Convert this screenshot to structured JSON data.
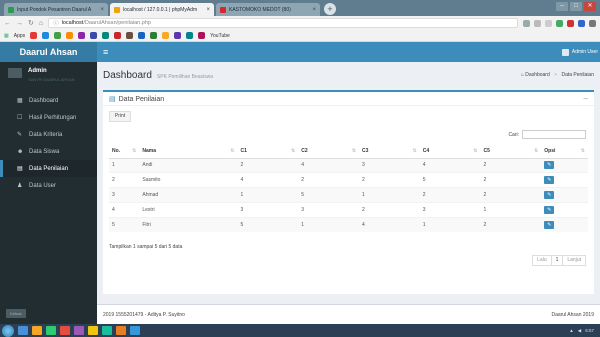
{
  "browser": {
    "tabs": [
      {
        "label": "Input Pondok Pesantren Daarul A",
        "color": "#2a9d4a",
        "active": false
      },
      {
        "label": "localhost / 127.0.0.1 | phpMyAdm",
        "color": "#f0a30a",
        "active": true
      },
      {
        "label": "KASTOMOKO MEDOT (80)",
        "color": "#d8262b",
        "active": false
      }
    ],
    "url_host": "localhost",
    "url_path": "/DaarulAhsan/penilaian.php",
    "bookmarks_label": "Apps",
    "bookmark_youtube": "YouTube",
    "bookmark_colors": [
      "#e53935",
      "#1e88e5",
      "#43a047",
      "#fb8c00",
      "#8e24aa",
      "#3949ab",
      "#00897b",
      "#c62828",
      "#6d4c41",
      "#1565c0",
      "#2e7d32",
      "#f9a825",
      "#5e35b1",
      "#00838f",
      "#ad1457"
    ]
  },
  "app": {
    "brand": "Daarul Ahsan",
    "user": {
      "name": "Admin",
      "subtitle": "SANTRI DAARUL AHSAN"
    },
    "nav_user": "Admin User",
    "menu": [
      {
        "label": "Dashboard",
        "icon": "dashboard-icon",
        "glyph": "▦",
        "active": false
      },
      {
        "label": "Hasil Perhitungan",
        "icon": "checkbox-icon",
        "glyph": "☐",
        "active": false
      },
      {
        "label": "Data Kriteria",
        "icon": "pencil-icon",
        "glyph": "✎",
        "active": false
      },
      {
        "label": "Data Siswa",
        "icon": "users-icon",
        "glyph": "☻",
        "active": false
      },
      {
        "label": "Data Penilaian",
        "icon": "table-icon",
        "glyph": "▤",
        "active": true
      },
      {
        "label": "Data User",
        "icon": "user-icon",
        "glyph": "♟",
        "active": false
      }
    ],
    "logout_label": "Keluar"
  },
  "header": {
    "title": "Dashboard",
    "subtitle": "SPK Pemilihan Beasiswa",
    "breadcrumb": [
      "Dashboard",
      "Data Penilaian"
    ]
  },
  "box": {
    "title": "Data Penilaian",
    "print_label": "Print",
    "search_label": "Cari:",
    "search_value": ""
  },
  "table": {
    "columns": [
      "No.",
      "Nama",
      "C1",
      "C2",
      "C3",
      "C4",
      "C5",
      "Opsi"
    ],
    "rows": [
      {
        "no": "1",
        "nama": "Andi",
        "c1": "2",
        "c2": "4",
        "c3": "3",
        "c4": "4",
        "c5": "2"
      },
      {
        "no": "2",
        "nama": "Sasmito",
        "c1": "4",
        "c2": "2",
        "c3": "2",
        "c4": "5",
        "c5": "2"
      },
      {
        "no": "3",
        "nama": "Ahmad",
        "c1": "1",
        "c2": "5",
        "c3": "1",
        "c4": "2",
        "c5": "2"
      },
      {
        "no": "4",
        "nama": "Lestri",
        "c1": "3",
        "c2": "3",
        "c3": "2",
        "c4": "3",
        "c5": "1"
      },
      {
        "no": "5",
        "nama": "Fitri",
        "c1": "5",
        "c2": "1",
        "c3": "4",
        "c4": "1",
        "c5": "2"
      }
    ],
    "info": "Tampilkan 1 sampai 5 dari 5 data",
    "pager": [
      "Lalu",
      "1",
      "Lanjut"
    ]
  },
  "footer": {
    "left": "2019 1555201479 - Aditya P. Suyitno",
    "right": "Daarul Ahsan 2019"
  },
  "taskbar": {
    "app_colors": [
      "#4a90d9",
      "#f5a623",
      "#2ecc71",
      "#e74c3c",
      "#9b59b6",
      "#f1c40f",
      "#1abc9c",
      "#e67e22",
      "#3498db"
    ],
    "clock": "6:57"
  }
}
